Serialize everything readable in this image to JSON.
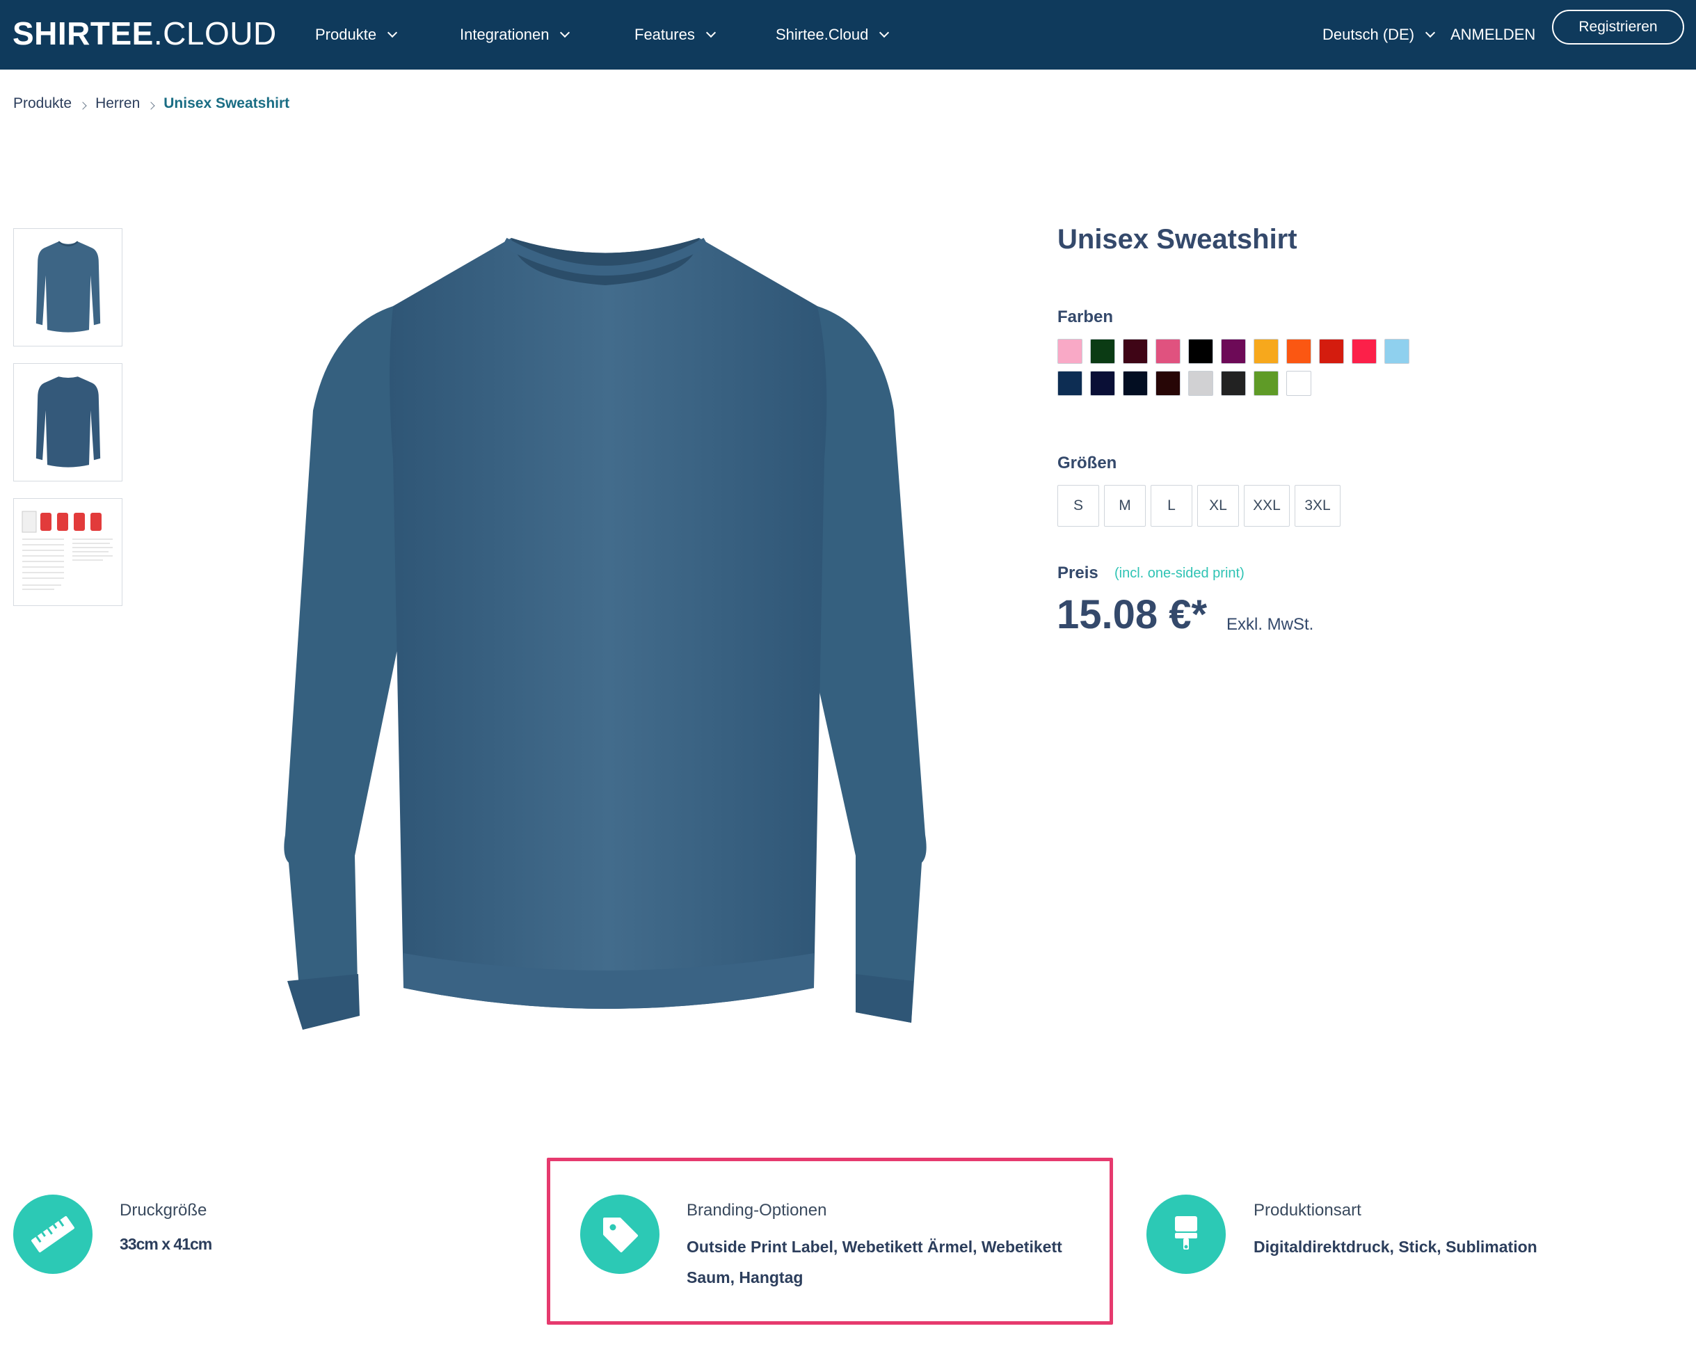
{
  "brand": {
    "logo_bold": "SHIRTEE",
    "logo_light": ".CLOUD"
  },
  "nav": {
    "items": [
      {
        "label": "Produkte"
      },
      {
        "label": "Integrationen"
      },
      {
        "label": "Features"
      },
      {
        "label": "Shirtee.Cloud"
      }
    ],
    "language": "Deutsch (DE)",
    "login": "ANMELDEN",
    "register": "Registrieren"
  },
  "breadcrumb": [
    "Produkte",
    "Herren",
    "Unisex Sweatshirt"
  ],
  "product": {
    "title": "Unisex Sweatshirt",
    "colors_label": "Farben",
    "colors": [
      "#f9a9c6",
      "#0b3b14",
      "#3f0516",
      "#e0527f",
      "#000000",
      "#6d0a57",
      "#f7a81c",
      "#fb5712",
      "#d41c0e",
      "#fc2049",
      "#8fd0ee",
      "#0d2d53",
      "#0a0f36",
      "#030e22",
      "#270606",
      "#d1d1d3",
      "#222222",
      "#5f9b27",
      "#ffffff"
    ],
    "sizes_label": "Größen",
    "sizes": [
      "S",
      "M",
      "L",
      "XL",
      "XXL",
      "3XL"
    ],
    "price_label": "Preis",
    "price_note": "(incl. one-sided print)",
    "price": "15.08 €*",
    "vat_note": "Exkl. MwSt.",
    "garment_color": "#3d6585"
  },
  "features": [
    {
      "label": "Druckgröße",
      "value": "33cm x 41cm",
      "icon": "ruler-icon"
    },
    {
      "label": "Branding-Optionen",
      "value_line1": "Outside Print Label, Webetikett Ärmel, Webetikett",
      "value_line2": "Saum, Hangtag",
      "icon": "tag-icon"
    },
    {
      "label": "Produktionsart",
      "value": "Digitaldirektdruck, Stick, Sublimation",
      "icon": "paint-roller-icon"
    }
  ],
  "colors": {
    "nav_bg": "#0f3a5c",
    "accent": "#2cc9b5",
    "highlight": "#e63a6e",
    "text": "#34496b"
  }
}
